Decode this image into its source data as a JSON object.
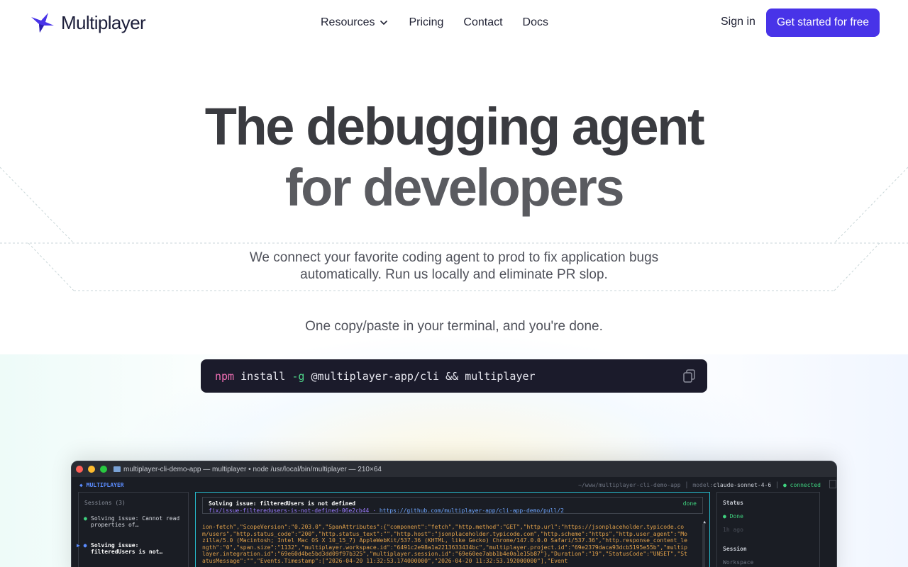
{
  "brand": {
    "name": "Multiplayer",
    "accent": "#4833e8"
  },
  "nav": {
    "links": [
      {
        "label": "Resources",
        "has_dropdown": true
      },
      {
        "label": "Pricing"
      },
      {
        "label": "Contact"
      },
      {
        "label": "Docs"
      }
    ],
    "signin_label": "Sign in",
    "cta_label": "Get started for free"
  },
  "hero": {
    "title_line1": "The debugging agent",
    "title_line2": "for developers",
    "subtitle": "We connect your favorite coding agent to prod to fix application bugs automatically. Run us locally and eliminate PR slop.",
    "note": "One copy/paste in your terminal, and you're done."
  },
  "command": {
    "cmd": "npm",
    "verb": "install",
    "flag": "-g",
    "rest": "@multiplayer-app/cli && multiplayer",
    "copy_icon": "copy-icon"
  },
  "terminal": {
    "title": "multiplayer-cli-demo-app — multiplayer • node /usr/local/bin/multiplayer — 210×64",
    "brand_label": "◆ MULTIPLAYER",
    "path": "~/www/multiplayer-cli-demo-app",
    "model_label": "model:",
    "model_value": "claude-sonnet-4-6",
    "connection": "● connected",
    "sessions_header": "Sessions (3)",
    "sessions": [
      {
        "bullet": "●",
        "text": "Solving issue: Cannot read properties of…",
        "active": false
      },
      {
        "bullet": "▶ ●",
        "text": "Solving issue: filteredUsers is not…",
        "active": true
      }
    ],
    "issue": {
      "title": "Solving issue: filteredUsers is not defined",
      "branch": "fix/issue-filteredusers-is-not-defined-06e2cb44",
      "separator": "·",
      "pr_url": "https://github.com/multiplayer-app/cli-app-demo/pull/2",
      "state": "done"
    },
    "log_text": "ion-fetch\",\"ScopeVersion\":\"0.203.0\",\"SpanAttributes\":{\"component\":\"fetch\",\"http.method\":\"GET\",\"http.url\":\"https://jsonplaceholder.typicode.com/users\",\"http.status_code\":\"200\",\"http.status_text\":\"\",\"http.host\":\"jsonplaceholder.typicode.com\",\"http.scheme\":\"https\",\"http.user_agent\":\"Mozilla/5.0 (Macintosh; Intel Mac OS X 10_15_7) AppleWebKit/537.36 (KHTML, like Gecko) Chrome/147.0.0.0 Safari/537.36\",\"http.response_content_length\":\"0\",\"span.size\":\"1132\",\"multiplayer.workspace.id\":\"6491c2e98a1a2213633434bc\",\"multiplayer.project.id\":\"69e2379daca93dcb5195e55b\",\"multiplayer.integration.id\":\"69e60d4be5bd3dd09f97b325\",\"multiplayer.session.id\":\"69e60ee7abb1b4e0a1e15b87\"},\"Duration\":\"19\",\"StatusCode\":\"UNSET\",\"StatusMessage\":\"\",\"Events.Timestamp\":[\"2026-04-20 11:32:53.174000000\",\"2026-04-20 11:32:53.192000000\"],\"Event",
    "status": {
      "status_label": "Status",
      "status_value": "● Done",
      "status_time": "1h ago",
      "session_label": "Session",
      "workspace_label": "Workspace"
    }
  }
}
